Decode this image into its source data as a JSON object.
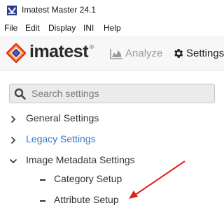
{
  "window": {
    "title": "Imatest Master 24.1",
    "icon": "imatest-app-icon"
  },
  "menubar": {
    "items": [
      "File",
      "Edit",
      "Display",
      "INI",
      "Help"
    ]
  },
  "header": {
    "logo_text": "imatest",
    "logo_mark": "®",
    "nav": [
      {
        "label": "Analyze",
        "icon": "chart-area-icon",
        "active": false
      },
      {
        "label": "Settings",
        "icon": "gear-icon",
        "active": true
      }
    ]
  },
  "search": {
    "placeholder": "Search settings",
    "value": ""
  },
  "tree": [
    {
      "label": "General Settings",
      "expander": "chevron-right",
      "style": "normal"
    },
    {
      "label": "Legacy Settings",
      "expander": "chevron-right",
      "style": "link"
    },
    {
      "label": "Image Metadata Settings",
      "expander": "chevron-down",
      "style": "normal",
      "children": [
        {
          "label": "Category Setup"
        },
        {
          "label": "Attribute Setup"
        }
      ]
    }
  ],
  "colors": {
    "link": "#3178c6",
    "annotation_arrow": "#e0201c",
    "header_bg": "#f7f7f7"
  },
  "annotation": {
    "type": "arrow",
    "target": "Attribute Setup"
  }
}
